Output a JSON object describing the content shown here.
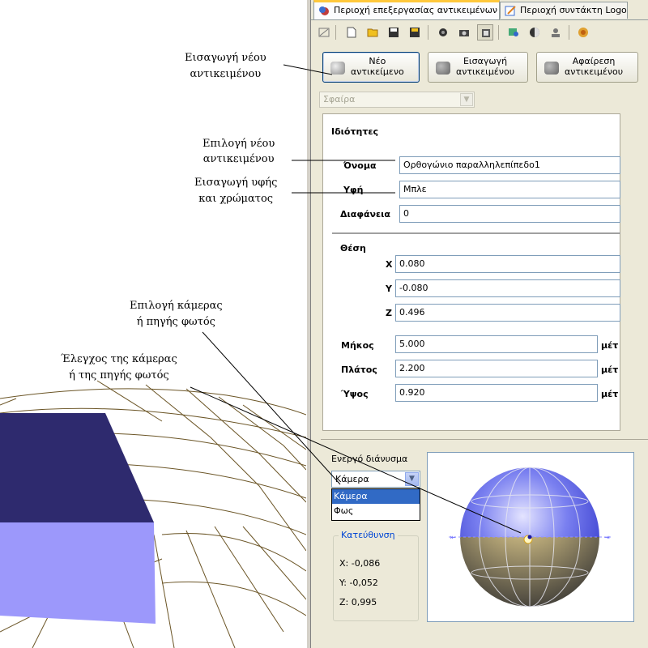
{
  "tabs": [
    {
      "label": "Περιοχή επεξεργασίας αντικειμένων",
      "active": true
    },
    {
      "label": "Περιοχή συντάκτη Logo",
      "active": false
    }
  ],
  "toolbar": {
    "icons": [
      "clear-icon",
      "new-file-icon",
      "open-folder-icon",
      "save-icon",
      "save-as-icon",
      "move-icon",
      "camera-icon",
      "frame-icon",
      "render-icon",
      "shading-icon",
      "user-icon",
      "settings-icon"
    ]
  },
  "actions": {
    "new_object": "Νέο\nαντικείμενο",
    "import_object": "Εισαγωγή\nαντικειμένου",
    "remove_object": "Αφαίρεση\nαντικειμένου"
  },
  "object_type": {
    "selected": "Σφαίρα"
  },
  "properties": {
    "title": "Ιδιότητες",
    "name_label": "Όνομα",
    "name_value": "Ορθογώνιο παραλληλεπίπεδο1",
    "texture_label": "Υφή",
    "texture_value": "Μπλε",
    "transparency_label": "Διαφάνεια",
    "transparency_value": "0",
    "position_label": "Θέση",
    "x_label": "X",
    "x_value": "0.080",
    "y_label": "Y",
    "y_value": "-0.080",
    "z_label": "Z",
    "z_value": "0.496",
    "length_label": "Μήκος",
    "length_value": "5.000",
    "width_label": "Πλάτος",
    "width_value": "2.200",
    "height_label": "Ύψος",
    "height_value": "0.920",
    "unit": "μέτ"
  },
  "vector": {
    "label": "Ενεργό διάνυσμα",
    "selected": "Κάμερα",
    "options": [
      "Κάμερα",
      "Φως"
    ],
    "direction_title": "Κατεύθυνση",
    "x": "X: -0,086",
    "y": "Y: -0,052",
    "z": "Z: 0,995"
  },
  "annotations": {
    "new_object": "Εισαγωγή νέου\nαντικειμένου",
    "choose_object": "Επιλογή νέου\nαντικειμένου",
    "texture_color": "Εισαγωγή υφής\nκαι χρώματος",
    "choose_camera": "Επιλογή κάμερας\nή πηγής φωτός",
    "control_camera": "Έλεγχος της κάμερας\nή της πηγής φωτός"
  },
  "colors": {
    "box_top": "#2e2a6e",
    "box_side": "#9c98fb",
    "grid": "#6b5526",
    "sphere_top": "#4e57e8",
    "sphere_bottom": "#8a7a55",
    "selection": "#316ac5"
  }
}
